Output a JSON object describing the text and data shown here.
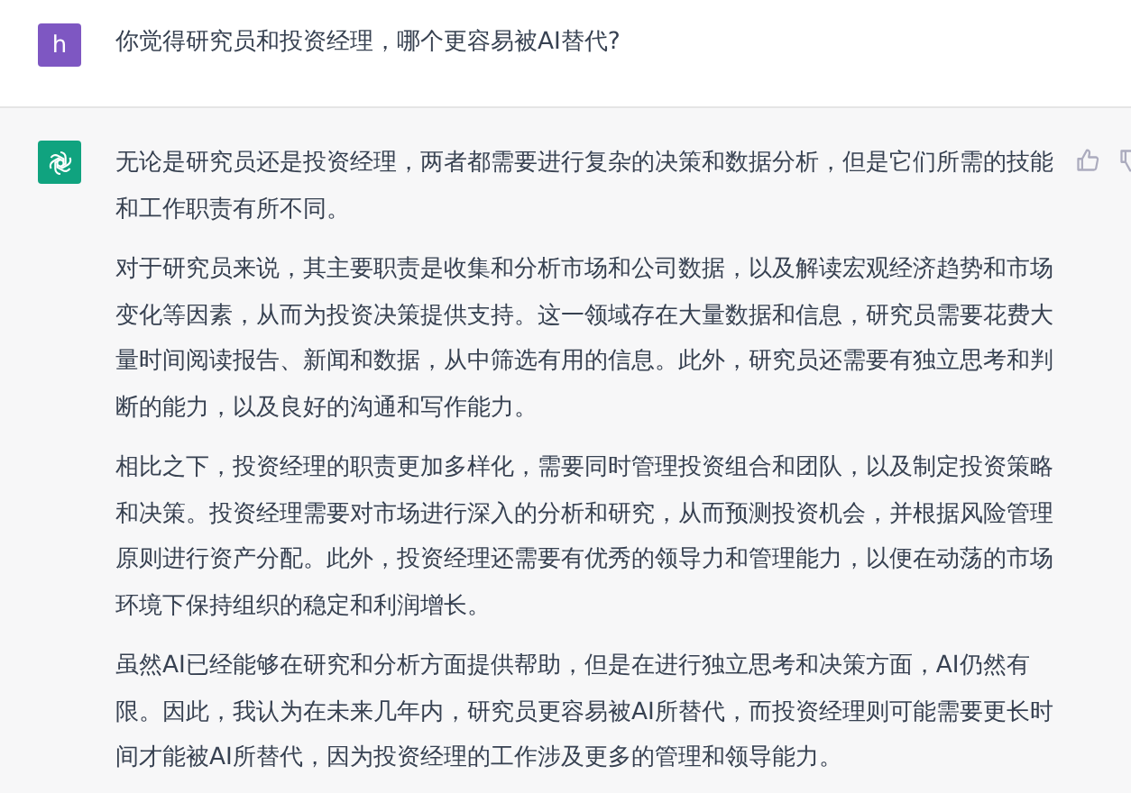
{
  "messages": [
    {
      "kind": "user",
      "avatar_letter": "h",
      "paragraphs": [
        "你觉得研究员和投资经理，哪个更容易被AI替代?"
      ]
    },
    {
      "kind": "assistant",
      "paragraphs": [
        "无论是研究员还是投资经理，两者都需要进行复杂的决策和数据分析，但是它们所需的技能和工作职责有所不同。",
        "对于研究员来说，其主要职责是收集和分析市场和公司数据，以及解读宏观经济趋势和市场变化等因素，从而为投资决策提供支持。这一领域存在大量数据和信息，研究员需要花费大量时间阅读报告、新闻和数据，从中筛选有用的信息。此外，研究员还需要有独立思考和判断的能力，以及良好的沟通和写作能力。",
        "相比之下，投资经理的职责更加多样化，需要同时管理投资组合和团队，以及制定投资策略和决策。投资经理需要对市场进行深入的分析和研究，从而预测投资机会，并根据风险管理原则进行资产分配。此外，投资经理还需要有优秀的领导力和管理能力，以便在动荡的市场环境下保持组织的稳定和利润增长。",
        "虽然AI已经能够在研究和分析方面提供帮助，但是在进行独立思考和决策方面，AI仍然有限。因此，我认为在未来几年内，研究员更容易被AI所替代，而投资经理则可能需要更长时间才能被AI所替代，因为投资经理的工作涉及更多的管理和领导能力。"
      ]
    }
  ]
}
